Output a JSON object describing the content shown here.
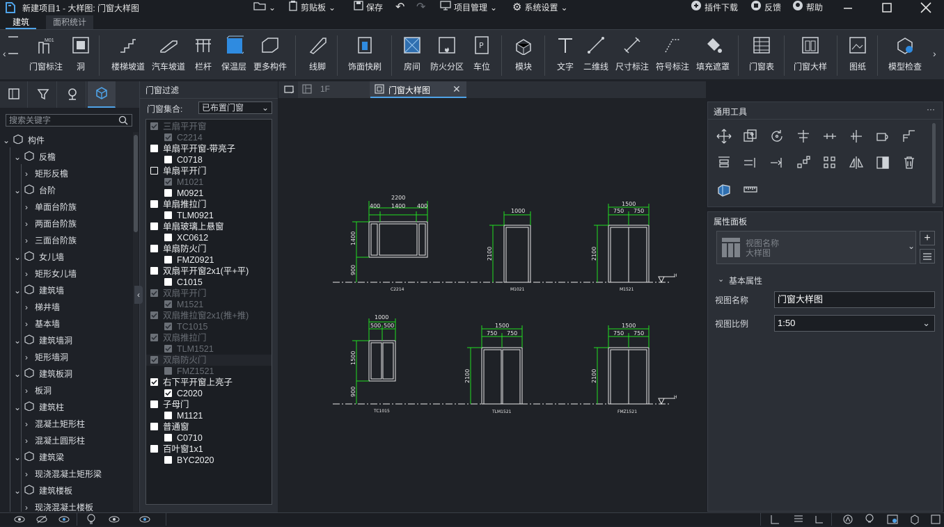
{
  "window": {
    "title": "新建项目1 - 大样图: 门窗大样图"
  },
  "menu": {
    "clipboard": "剪贴板",
    "save": "保存",
    "project_mgmt": "项目管理",
    "system_settings": "系统设置",
    "plugin_download": "插件下载",
    "feedback": "反馈",
    "help": "帮助"
  },
  "ribbon_tabs": [
    "建筑",
    "面积统计"
  ],
  "ribbon": [
    "门窗标注",
    "洞",
    "楼梯坡道",
    "汽车坡道",
    "栏杆",
    "保温层",
    "更多构件",
    "线脚",
    "饰面快刷",
    "房间",
    "防火分区",
    "车位",
    "模块",
    "文字",
    "二维线",
    "尺寸标注",
    "符号标注",
    "填充遮罩",
    "门窗表",
    "门窗大样",
    "图纸",
    "模型检查"
  ],
  "ribbon_small": {
    "m01": "M01"
  },
  "left": {
    "search_placeholder": "搜索关键字",
    "tree": [
      "构件",
      "反檐",
      "矩形反檐",
      "台阶",
      "单面台阶族",
      "两面台阶族",
      "三面台阶族",
      "女儿墙",
      "矩形女儿墙",
      "建筑墙",
      "梯井墙",
      "基本墙",
      "建筑墙洞",
      "矩形墙洞",
      "建筑板洞",
      "板洞",
      "建筑柱",
      "混凝土矩形柱",
      "混凝土圆形柱",
      "建筑梁",
      "现浇混凝土矩形梁",
      "建筑楼板",
      "现浇混凝土楼板"
    ]
  },
  "filter": {
    "title": "门窗过滤",
    "collection_label": "门窗集合:",
    "collection_value": "已布置门窗",
    "items": [
      "三扇平开窗",
      "C2214",
      "单扇平开窗-带亮子",
      "C0718",
      "单扇平开门",
      "M1021",
      "M0921",
      "单扇推拉门",
      "TLM0921",
      "单扇玻璃上悬窗",
      "XC0612",
      "单扇防火门",
      "FMZ0921",
      "双扇平开窗2x1(平+平)",
      "C1015",
      "双扇平开门",
      "M1521",
      "双扇推拉窗2x1(推+推)",
      "TC1015",
      "双扇推拉门",
      "TLM1521",
      "双扇防火门",
      "FMZ1521",
      "右下平开窗上亮子",
      "C2020",
      "子母门",
      "M1121",
      "普通窗",
      "C0710",
      "百叶窗1x1",
      "BYC2020"
    ]
  },
  "canvas_tabs": {
    "tab1": "1F",
    "tab2": "门窗大样图"
  },
  "drawing": {
    "d1": {
      "top": "2200",
      "parts": [
        "400",
        "1400",
        "400"
      ],
      "left_top": "1400",
      "left_bottom": "900",
      "tag": "C2214"
    },
    "d2": {
      "top": "1000",
      "left": "2100",
      "tag": "M1021"
    },
    "d3": {
      "top": "1500",
      "parts": [
        "750",
        "750"
      ],
      "left": "2100",
      "tag": "M1521"
    },
    "d4": {
      "top": "1000",
      "parts": [
        "500",
        "500"
      ],
      "left_top": "1500",
      "left_bottom": "900",
      "tag": "TC1015"
    },
    "d5": {
      "top": "1500",
      "parts": [
        "750",
        "750"
      ],
      "left": "2100",
      "tag": "TLM1521"
    },
    "d6": {
      "top": "1500",
      "parts": [
        "750",
        "750"
      ],
      "left": "2100",
      "tag": "FMZ1521"
    },
    "level_mark": "H"
  },
  "tools_panel": {
    "title": "通用工具",
    "more": "···"
  },
  "props": {
    "title": "属性面板",
    "view_name_hint": "视图名称",
    "view_type": "大样图",
    "section": "基本属性",
    "name_label": "视图名称",
    "name_value": "门窗大样图",
    "scale_label": "视图比例",
    "scale_value": "1:50"
  }
}
